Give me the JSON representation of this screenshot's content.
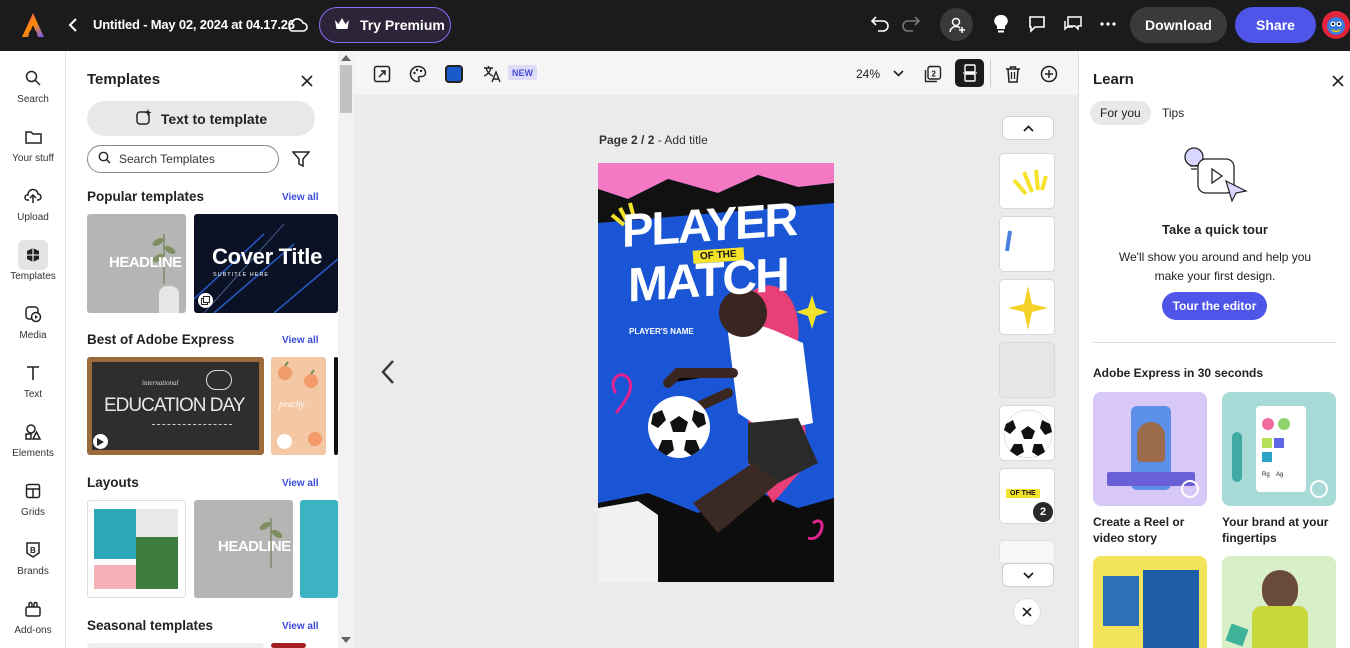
{
  "topbar": {
    "title": "Untitled - May 02, 2024 at 04.17.26",
    "premium_label": "Try Premium",
    "download_label": "Download",
    "share_label": "Share",
    "colors": {
      "bg": "#1b1b1b",
      "share": "#4e55e8"
    }
  },
  "leftrail": {
    "items": [
      {
        "label": "Search",
        "icon": "search-icon"
      },
      {
        "label": "Your stuff",
        "icon": "folder-icon"
      },
      {
        "label": "Upload",
        "icon": "upload-icon"
      },
      {
        "label": "Templates",
        "icon": "templates-icon"
      },
      {
        "label": "Media",
        "icon": "media-icon"
      },
      {
        "label": "Text",
        "icon": "text-icon"
      },
      {
        "label": "Elements",
        "icon": "elements-icon"
      },
      {
        "label": "Grids",
        "icon": "grids-icon"
      },
      {
        "label": "Brands",
        "icon": "brands-icon"
      },
      {
        "label": "Add-ons",
        "icon": "addons-icon"
      }
    ]
  },
  "templates_panel": {
    "title": "Templates",
    "text_to_template": "Text to template",
    "search_placeholder": "Search Templates",
    "sections": [
      {
        "title": "Popular templates",
        "view_all": "View all"
      },
      {
        "title": "Best of Adobe Express",
        "view_all": "View all"
      },
      {
        "title": "Layouts",
        "view_all": "View all"
      },
      {
        "title": "Seasonal templates",
        "view_all": "View all"
      }
    ],
    "thumb_texts": {
      "headline": "HEADLINE",
      "cover_title": "Cover Title",
      "subtitle_here": "SUBTITLE HERE",
      "education_small": "international",
      "education": "EDUCATION DAY",
      "peachy": "peachy",
      "headline2": "HEADLINE"
    }
  },
  "toolbar": {
    "new_badge": "NEW",
    "zoom": "24%"
  },
  "canvas": {
    "page_label": "Page 2 / 2",
    "add_title": "Add title",
    "poster": {
      "line1": "PLAYER",
      "of_the": "OF THE",
      "line2": "MATCH",
      "players_name": "PLAYER'S NAME"
    },
    "page_badge": "2",
    "of_the_thumb": "OF THE"
  },
  "learn": {
    "title": "Learn",
    "tabs": [
      "For you",
      "Tips"
    ],
    "tour_title": "Take a quick tour",
    "tour_text": "We'll show you around and help you make your first design.",
    "tour_button": "Tour the editor",
    "section_title": "Adobe Express in 30 seconds",
    "cards": [
      {
        "label": "Create a Reel or video story"
      },
      {
        "label": "Your brand at your fingertips"
      }
    ],
    "brand_mini": [
      "Rg",
      "Ag"
    ]
  }
}
